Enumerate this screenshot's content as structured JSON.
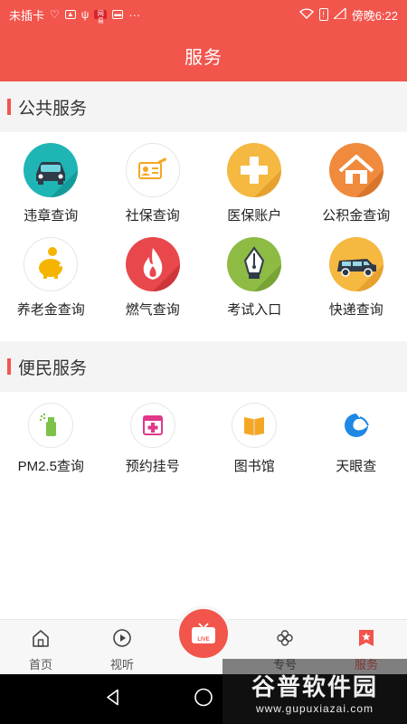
{
  "status": {
    "carrier": "未插卡",
    "battery_indicator": "!",
    "time": "傍晚6:22",
    "red_badge": "网易"
  },
  "header": {
    "title": "服务"
  },
  "public_services": {
    "title": "公共服务",
    "items": [
      {
        "label": "违章查询",
        "icon": "car-icon",
        "color": "#1fb5b5"
      },
      {
        "label": "社保查询",
        "icon": "id-card-icon",
        "color": "#f5a623"
      },
      {
        "label": "医保账户",
        "icon": "medical-cross-icon",
        "color": "#f5b841"
      },
      {
        "label": "公积金查询",
        "icon": "house-icon",
        "color": "#f08a3c"
      },
      {
        "label": "养老金查询",
        "icon": "piggy-bank-icon",
        "color": "#f5b400"
      },
      {
        "label": "燃气查询",
        "icon": "flame-icon",
        "color": "#e8474c"
      },
      {
        "label": "考试入口",
        "icon": "pen-nib-icon",
        "color": "#8dbb44"
      },
      {
        "label": "快递查询",
        "icon": "delivery-van-icon",
        "color": "#f5b841"
      }
    ]
  },
  "convenience_services": {
    "title": "便民服务",
    "items": [
      {
        "label": "PM2.5查询",
        "icon": "air-spray-icon",
        "color": "#7cc24a"
      },
      {
        "label": "预约挂号",
        "icon": "hospital-plus-icon",
        "color": "#e0388a"
      },
      {
        "label": "图书馆",
        "icon": "book-icon",
        "color": "#f5a623"
      },
      {
        "label": "天眼查",
        "icon": "tianyan-logo-icon",
        "color": "#1e88e5"
      }
    ]
  },
  "tabs": [
    {
      "label": "首页",
      "icon": "home-icon"
    },
    {
      "label": "视听",
      "icon": "play-icon"
    },
    {
      "label": "",
      "icon": "live-tv-icon",
      "badge": "LIVE"
    },
    {
      "label": "专号",
      "icon": "clover-icon"
    },
    {
      "label": "服务",
      "icon": "star-bookmark-icon"
    }
  ],
  "watermark": {
    "title": "谷普软件园",
    "url": "www.gupuxiazai.com"
  }
}
